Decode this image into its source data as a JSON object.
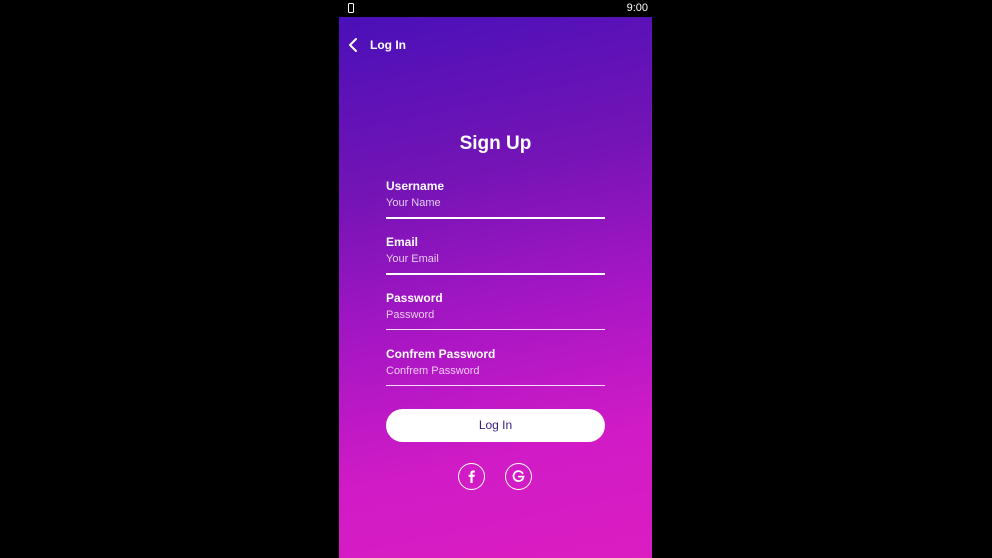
{
  "status_bar": {
    "time": "9:00",
    "icon": "phone-icon"
  },
  "nav": {
    "back_label": "Log In",
    "icon": "chevron-left-icon"
  },
  "form": {
    "title": "Sign Up",
    "fields": [
      {
        "label": "Username",
        "placeholder": "Your Name",
        "value": ""
      },
      {
        "label": "Email",
        "placeholder": "Your Email",
        "value": ""
      },
      {
        "label": "Password",
        "placeholder": "Password",
        "value": ""
      },
      {
        "label": "Confrem Password",
        "placeholder": "Confrem Password",
        "value": ""
      }
    ],
    "submit_label": "Log In"
  },
  "social": [
    {
      "icon": "facebook-icon"
    },
    {
      "icon": "google-icon"
    }
  ],
  "colors": {
    "gradient_top": "#4a10b8",
    "gradient_bottom": "#db1dc1",
    "button_text": "#3a1b78"
  }
}
